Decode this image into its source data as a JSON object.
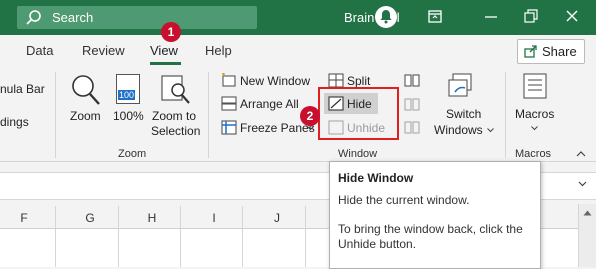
{
  "title_bar": {
    "search_label": "Search",
    "user_name": "Brain Bell",
    "accent": "#217346"
  },
  "tabs": [
    {
      "label": "Data"
    },
    {
      "label": "Review"
    },
    {
      "label": "View",
      "active": true
    },
    {
      "label": "Help"
    }
  ],
  "share_label": "Share",
  "ribbon": {
    "partial_left": {
      "line1": "nula Bar",
      "line2": "dings"
    },
    "zoom_group": {
      "zoom": "Zoom",
      "hundred": "100%",
      "zoom_to_selection_1": "Zoom to",
      "zoom_to_selection_2": "Selection",
      "label": "Zoom",
      "hundred_icon_text": "100"
    },
    "window_group": {
      "new_window": "New Window",
      "arrange_all": "Arrange All",
      "freeze_panes": "Freeze Panes",
      "split": "Split",
      "hide": "Hide",
      "unhide": "Unhide",
      "switch_windows_1": "Switch",
      "switch_windows_2": "Windows",
      "label": "Window"
    },
    "macros_group": {
      "macros": "Macros",
      "label": "Macros"
    }
  },
  "callouts": [
    "1",
    "2"
  ],
  "columns": [
    "F",
    "G",
    "H",
    "I",
    "J"
  ],
  "tooltip": {
    "title": "Hide Window",
    "line1": "Hide the current window.",
    "line2": "To bring the window back, click the",
    "line3": "Unhide button."
  }
}
